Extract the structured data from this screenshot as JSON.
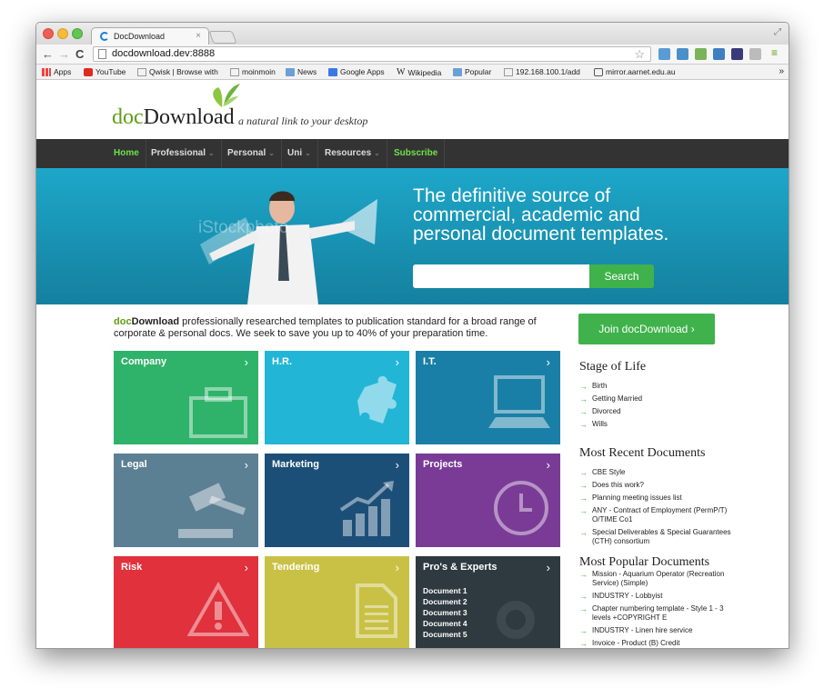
{
  "browser": {
    "tab_title": "DocDownload",
    "tab_close": "×",
    "url": "docdownload.dev:8888",
    "bookmarks": [
      "Apps",
      "YouTube",
      "Qwisk | Browse with",
      "moinmoin",
      "News",
      "Google Apps",
      "Wikipedia",
      "Popular",
      "192.168.100.1/add",
      "mirror.aarnet.edu.au"
    ],
    "more": "»"
  },
  "site": {
    "logo_doc": "doc",
    "logo_download": "Download",
    "tagline": "a natural link to your desktop"
  },
  "nav": [
    "Home",
    "Professional",
    "Personal",
    "Uni",
    "Resources",
    "Subscribe"
  ],
  "hero": {
    "title": "The definitive source of commercial, academic and personal document templates.",
    "search_button": "Search",
    "watermark": "iStockphoto"
  },
  "intro": {
    "brand_doc": "doc",
    "brand_download": "Download",
    "text": " professionally researched templates to publication standard for a broad range of corporate & personal docs. We seek to save you up to 40% of your preparation time."
  },
  "join_button": "Join docDownload  ›",
  "tiles": [
    {
      "title": "Company",
      "color": "#2fb36a"
    },
    {
      "title": "H.R.",
      "color": "#22b5d6"
    },
    {
      "title": "I.T.",
      "color": "#1a7fa6"
    },
    {
      "title": "Legal",
      "color": "#5b7f93"
    },
    {
      "title": "Marketing",
      "color": "#1c4f78"
    },
    {
      "title": "Projects",
      "color": "#7a3b97"
    },
    {
      "title": "Risk",
      "color": "#e0313c"
    },
    {
      "title": "Tendering",
      "color": "#c9c145"
    },
    {
      "title": "Pro's & Experts",
      "color": "#2e3a3f"
    }
  ],
  "tile_arrow": "›",
  "experts_docs": [
    "Document 1",
    "Document 2",
    "Document 3",
    "Document 4",
    "Document 5"
  ],
  "sidebar": {
    "stage_title": "Stage of Life",
    "stage_items": [
      "Birth",
      "Getting Married",
      "Divorced",
      "Wills"
    ],
    "recent_title": "Most Recent Documents",
    "recent_items": [
      "CBE Style",
      "Does this work?",
      "Planning meeting issues list",
      "ANY - Contract of Employment (PermP/T) O/TIME Co1",
      "Special Deliverables & Special Guarantees (CTH) consortium"
    ],
    "popular_title": "Most Popular Documents",
    "popular_items": [
      "Mission - Aquarium Operator (Recreation Service) (Simple)",
      "INDUSTRY - Lobbyist",
      "Chapter numbering template - Style 1 - 3 levels +COPYRIGHT E",
      "INDUSTRY - Linen hire service",
      "Invoice - Product (B) Credit"
    ]
  }
}
